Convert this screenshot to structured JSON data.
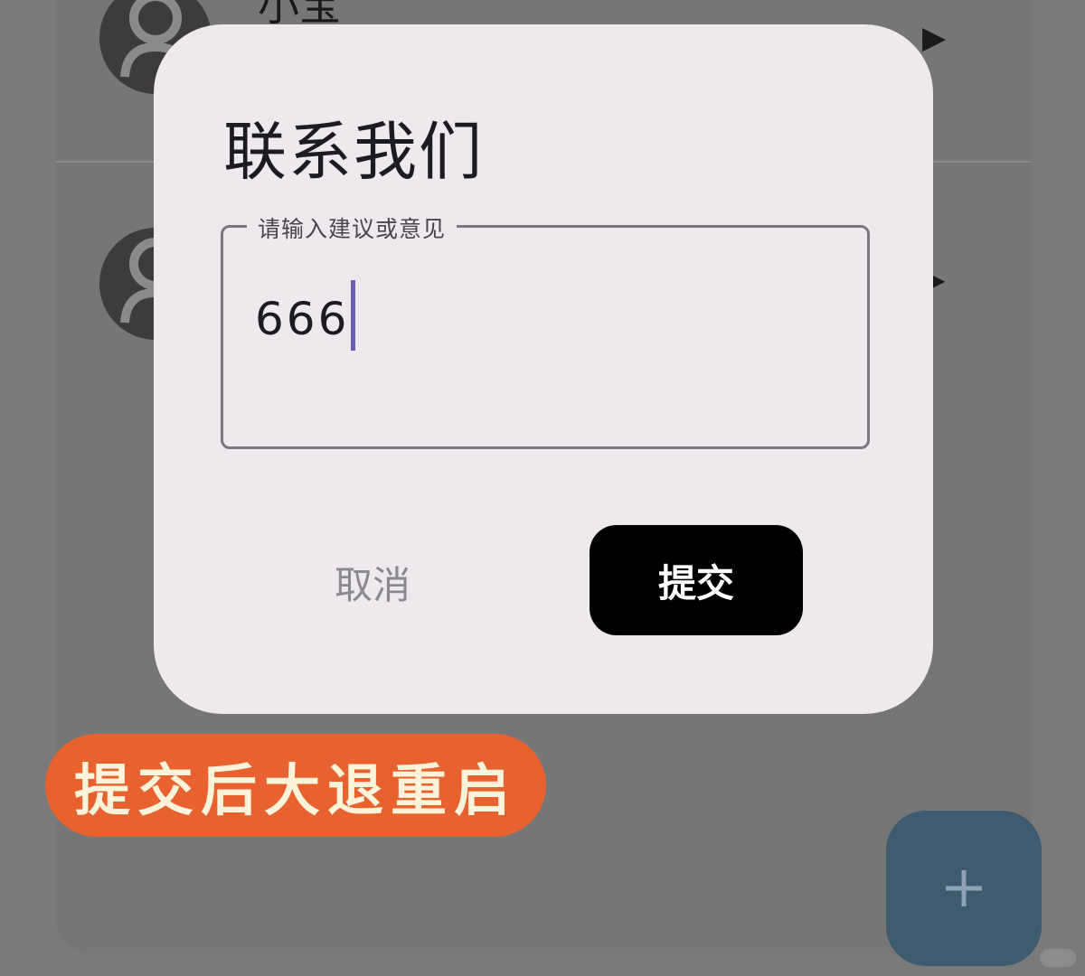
{
  "background_list": {
    "items": [
      {
        "name": "小宝"
      },
      {
        "name": ""
      }
    ],
    "icons": {
      "avatar": "person-icon",
      "chevron": "chevron-right-icon"
    }
  },
  "dialog": {
    "title": "联系我们",
    "input": {
      "label": "请输入建议或意见",
      "value": "666"
    },
    "cancel_label": "取消",
    "submit_label": "提交"
  },
  "caption": "提交后大退重启",
  "fab": {
    "icon": "plus-icon"
  },
  "colors": {
    "scrim": "#7a7a7a",
    "dialog_bg": "#ede9ed",
    "submit_bg": "#000000",
    "caption_bg": "#e8622f",
    "caption_text": "#fdf2da",
    "fab_bg": "#3e5b70",
    "caret": "#6a5fb0"
  }
}
